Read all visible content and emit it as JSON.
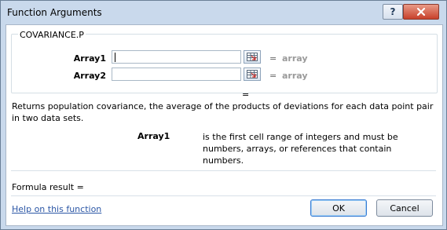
{
  "window": {
    "title": "Function Arguments"
  },
  "titlebar_buttons": {
    "help": "?",
    "close_icon": "close-icon"
  },
  "function_group": {
    "name": "COVARIANCE.P",
    "args": [
      {
        "label": "Array1",
        "value": "",
        "equals": "=",
        "result": "array"
      },
      {
        "label": "Array2",
        "value": "",
        "equals": "=",
        "result": "array"
      }
    ],
    "result_equals": "="
  },
  "description": "Returns population covariance, the average of the products of deviations for each data point pair in two data sets.",
  "arg_help": {
    "name": "Array1",
    "text": "is the first cell range of integers and must be numbers, arrays, or references that contain numbers."
  },
  "formula_result_label": "Formula result =",
  "help_link": "Help on this function",
  "buttons": {
    "ok": "OK",
    "cancel": "Cancel"
  },
  "colors": {
    "titlebar": "#c9d9ec",
    "close": "#c7412b",
    "link": "#2c57a6"
  }
}
